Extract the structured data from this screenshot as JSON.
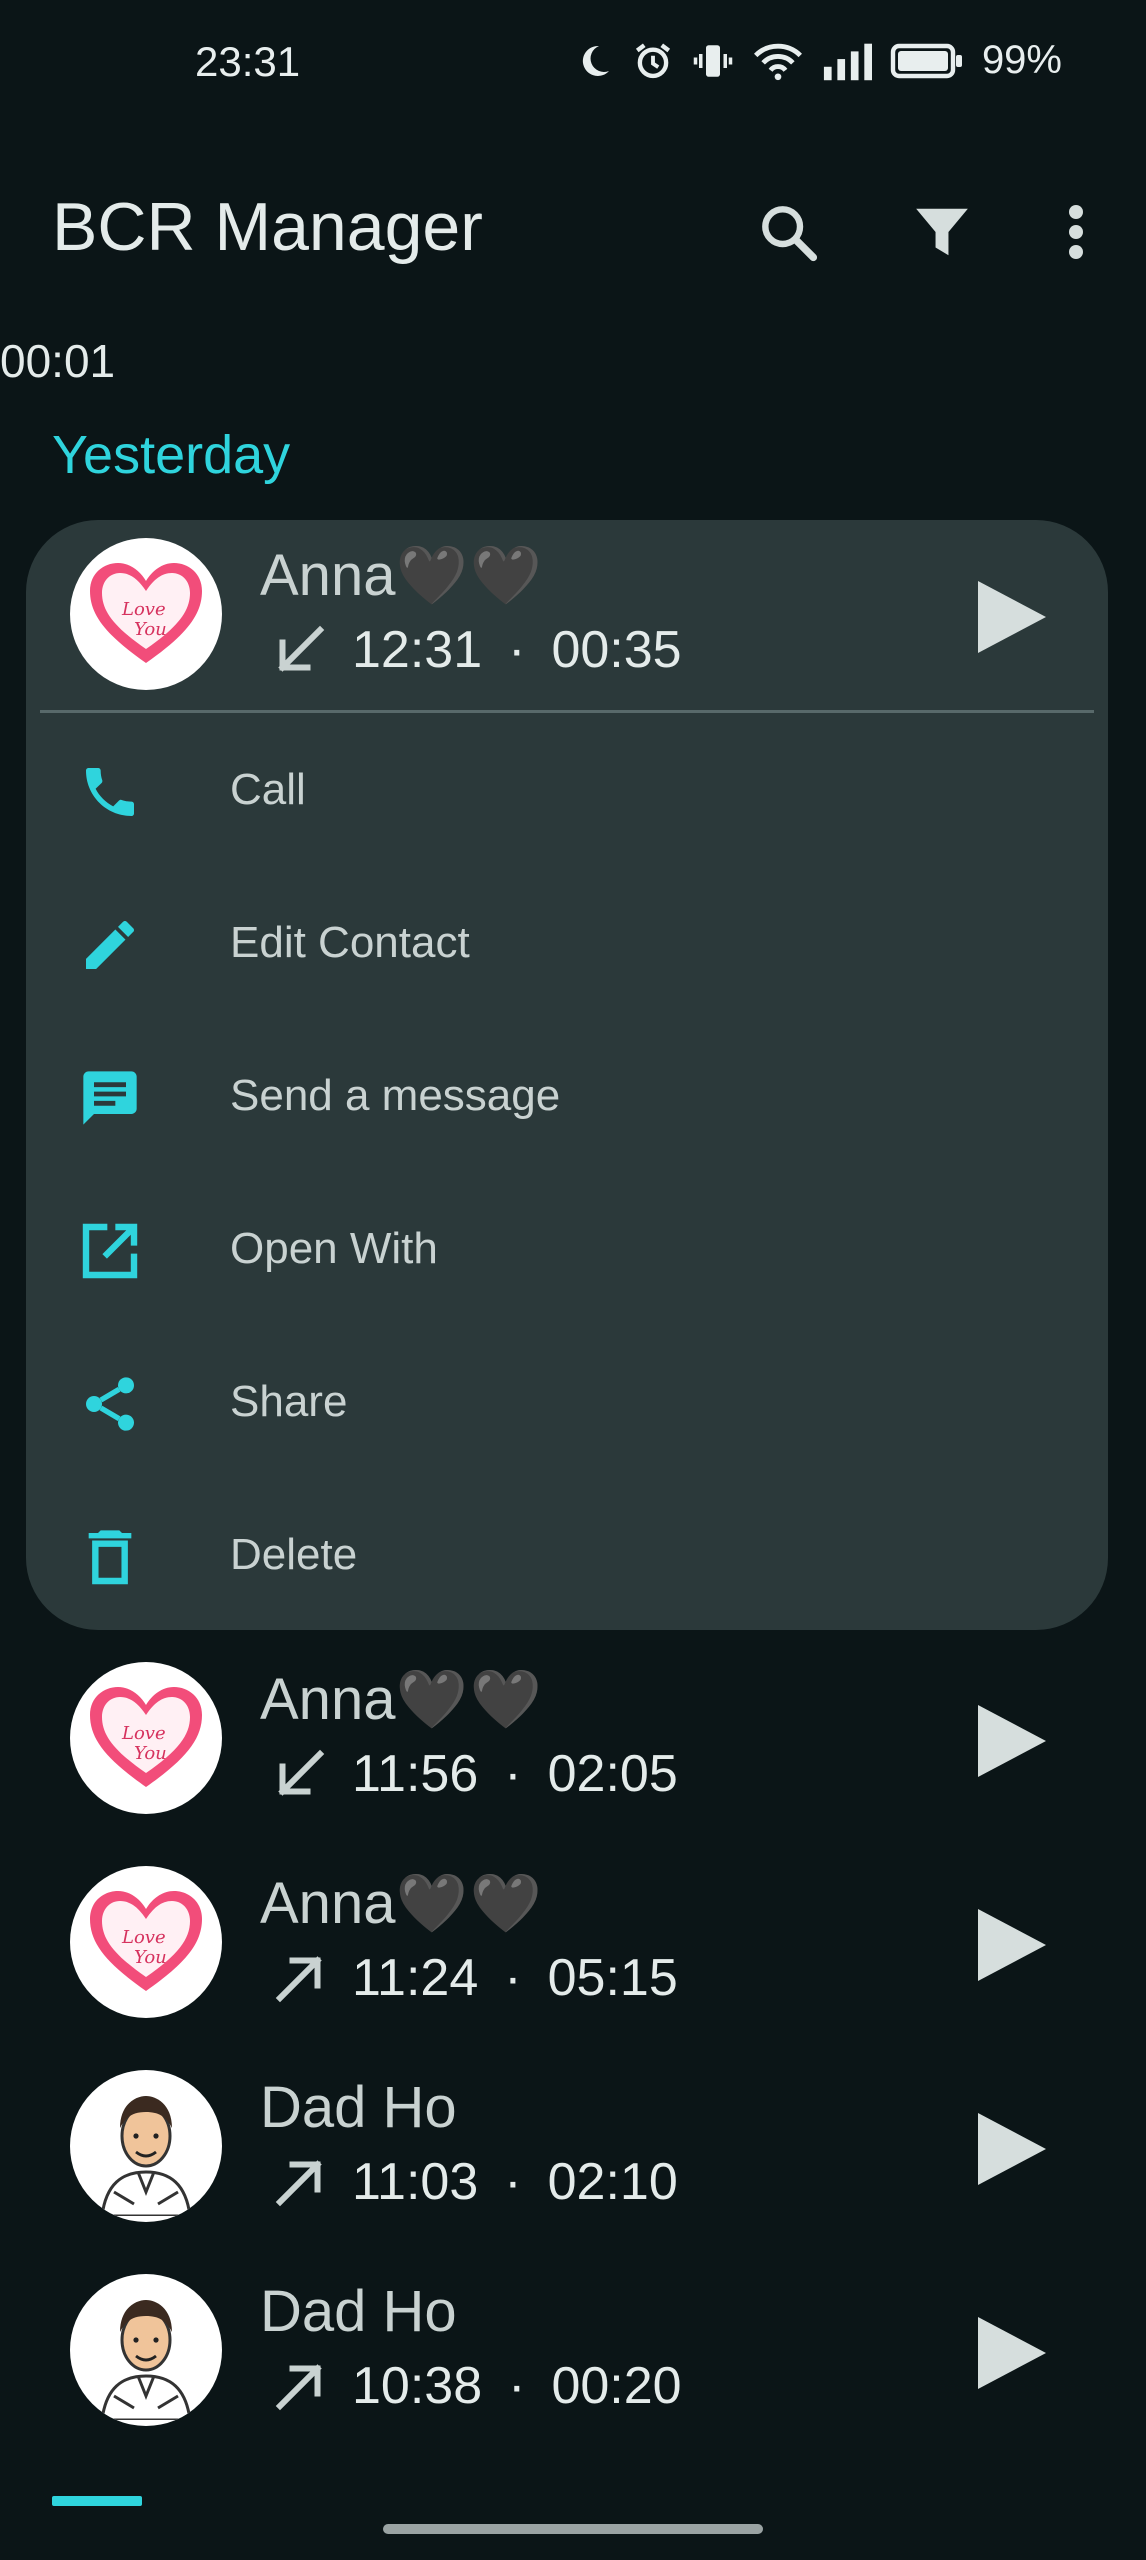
{
  "status_bar": {
    "time": "23:31",
    "battery": "99%",
    "icons": [
      "moon-icon",
      "alarm-icon",
      "vibrate-icon",
      "wifi-icon",
      "signal-icon",
      "battery-icon"
    ]
  },
  "app_bar": {
    "title": "BCR Manager",
    "actions": [
      "search-icon",
      "filter-icon",
      "more-vert-icon"
    ]
  },
  "stray_time": "00:01",
  "section": {
    "header": "Yesterday"
  },
  "expanded_call": {
    "name": "Anna",
    "hearts": "🖤🖤",
    "direction": "incoming",
    "time": "12:31",
    "separator": "·",
    "duration": "00:35"
  },
  "menu": [
    {
      "label": "Call",
      "icon": "phone-icon"
    },
    {
      "label": "Edit Contact",
      "icon": "pencil-icon"
    },
    {
      "label": "Send a message",
      "icon": "message-icon"
    },
    {
      "label": "Open With",
      "icon": "open-external-icon"
    },
    {
      "label": "Share",
      "icon": "share-icon"
    },
    {
      "label": "Delete",
      "icon": "trash-icon"
    }
  ],
  "calls": [
    {
      "name": "Anna",
      "hearts": "🖤🖤",
      "direction": "incoming",
      "time": "11:56",
      "separator": "·",
      "duration": "02:05",
      "avatar": "love-heart-avatar"
    },
    {
      "name": "Anna",
      "hearts": "🖤🖤",
      "direction": "outgoing",
      "time": "11:24",
      "separator": "·",
      "duration": "05:15",
      "avatar": "love-heart-avatar"
    },
    {
      "name": "Dad Ho",
      "hearts": "",
      "direction": "outgoing",
      "time": "11:03",
      "separator": "·",
      "duration": "02:10",
      "avatar": "cartoon-man-avatar"
    },
    {
      "name": "Dad Ho",
      "hearts": "",
      "direction": "outgoing",
      "time": "10:38",
      "separator": "·",
      "duration": "00:20",
      "avatar": "cartoon-man-avatar"
    }
  ],
  "colors": {
    "background": "#0b1517",
    "card": "#2b393a",
    "accent": "#2fd4dd",
    "text_primary": "#e4ebea",
    "text_secondary": "#c9d2d1"
  }
}
